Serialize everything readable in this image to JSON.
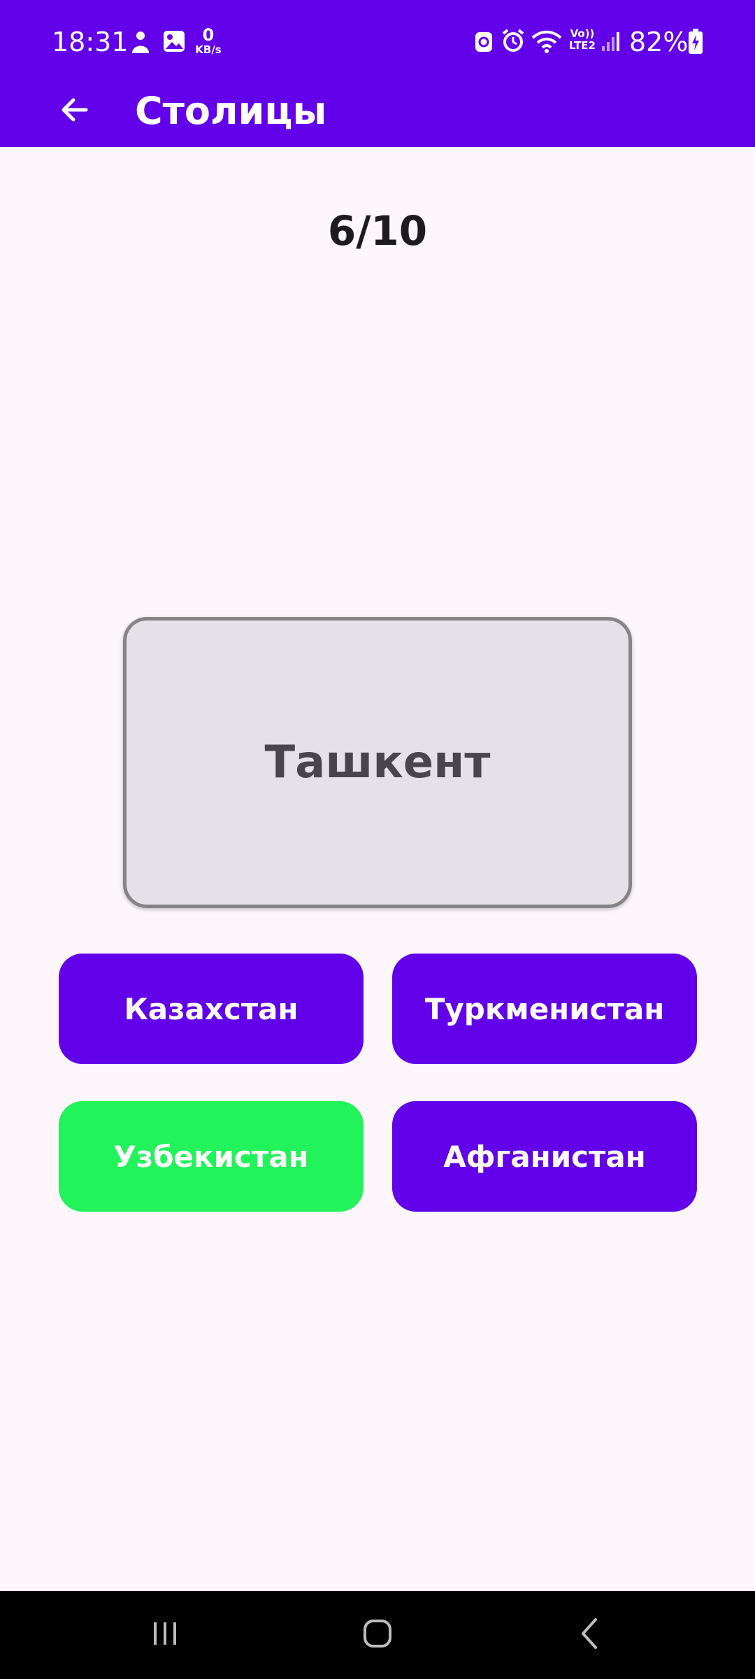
{
  "status_bar": {
    "time": "18:31",
    "net_speed_value": "0",
    "net_speed_unit": "KB/s",
    "volte_line1": "Vo))",
    "volte_line2": "LTE2",
    "battery": "82%",
    "icons": [
      "bixby-icon",
      "gallery-icon",
      "sim-icon",
      "alarm-icon",
      "wifi-icon",
      "signal-icon",
      "battery-charging-icon"
    ]
  },
  "app_bar": {
    "title": "Столицы",
    "back_icon": "arrow-left-icon"
  },
  "quiz": {
    "progress": "6/10",
    "question": "Ташкент",
    "answers": [
      {
        "label": "Казахстан",
        "state": "default"
      },
      {
        "label": "Туркменистан",
        "state": "default"
      },
      {
        "label": "Узбекистан",
        "state": "correct"
      },
      {
        "label": "Афганистан",
        "state": "default"
      }
    ]
  },
  "colors": {
    "primary": "#6200EA",
    "correct": "#22F35A",
    "card_bg": "#E6E1E9",
    "page_bg": "#FDF7FC"
  },
  "nav_bar": {
    "icons": [
      "recent-apps-icon",
      "home-icon",
      "back-icon"
    ]
  }
}
